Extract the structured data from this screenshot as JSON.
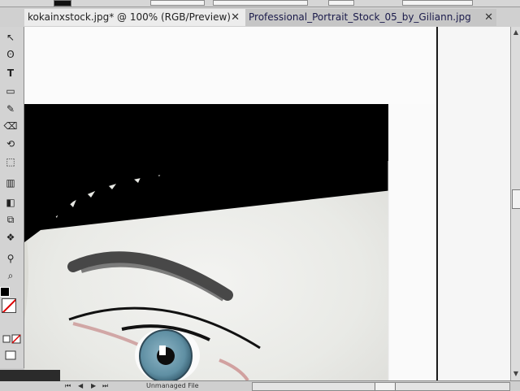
{
  "document_tabs": [
    {
      "label": "kokainxstock.jpg* @ 100% (RGB/Preview)",
      "close": "✕"
    },
    {
      "label": "Professional_Portrait_Stock_05_by_Giliann.jpg",
      "close": "✕"
    }
  ],
  "status_bar": {
    "file_label": "Unmanaged File",
    "nav_first": "⏮",
    "nav_prev": "◀",
    "nav_next": "▶",
    "nav_last": "⏭"
  },
  "tools": [
    {
      "name": "selection-tool",
      "glyph": "↖"
    },
    {
      "name": "lasso-tool",
      "glyph": "ʘ"
    },
    {
      "name": "type-tool",
      "glyph": "T"
    },
    {
      "name": "rectangle-tool",
      "glyph": "▭"
    },
    {
      "name": "brush-tool",
      "glyph": "✎"
    },
    {
      "name": "eraser-tool",
      "glyph": "⌫"
    },
    {
      "name": "rotate-tool",
      "glyph": "⟲"
    },
    {
      "name": "free-transform-tool",
      "glyph": "⬚"
    },
    {
      "name": "graph-tool",
      "glyph": "▥"
    },
    {
      "name": "gradient-tool",
      "glyph": "◧"
    },
    {
      "name": "blend-tool",
      "glyph": "⧉"
    },
    {
      "name": "symbol-sprayer-tool",
      "glyph": "❖"
    },
    {
      "name": "eyedropper-tool",
      "glyph": "⚲"
    },
    {
      "name": "zoom-tool",
      "glyph": "⌕"
    }
  ],
  "colors": {
    "foreground": "#000000",
    "background": "#ffffff",
    "none_stroke": "#dd0000"
  }
}
